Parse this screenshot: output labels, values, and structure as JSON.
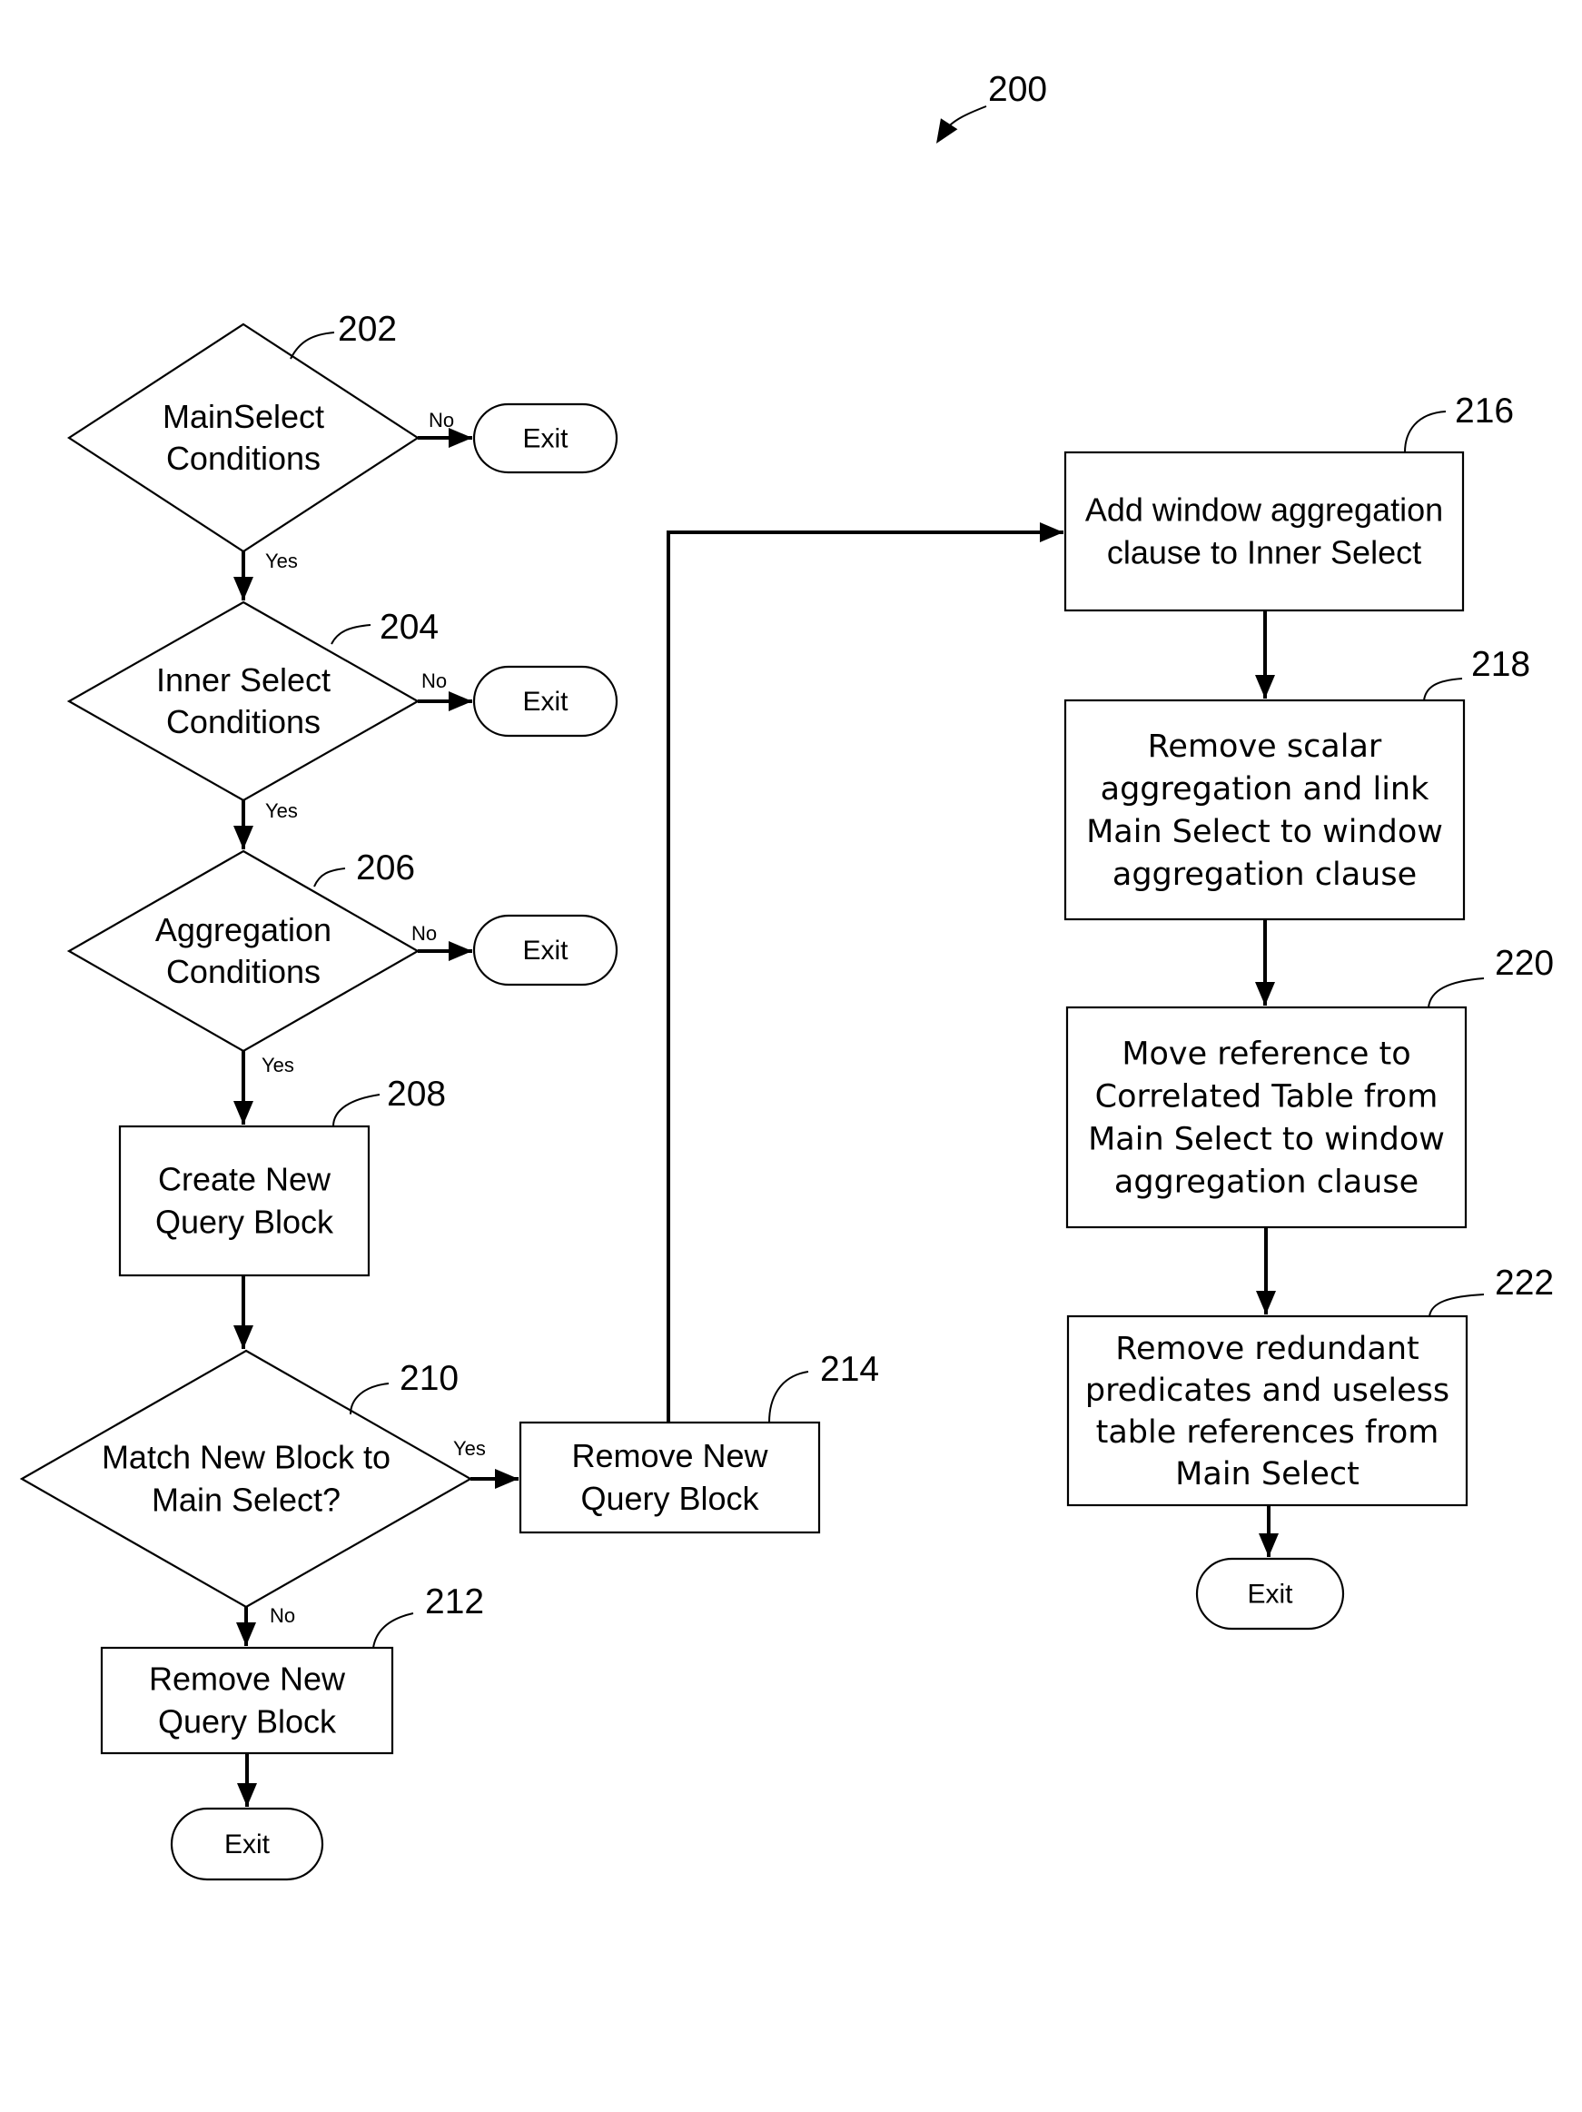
{
  "figure": {
    "reference": "200"
  },
  "nodes": {
    "n202": {
      "ref": "202",
      "type": "decision",
      "lines": [
        "MainSelect",
        "Conditions"
      ]
    },
    "n204": {
      "ref": "204",
      "type": "decision",
      "lines": [
        "Inner Select",
        "Conditions"
      ]
    },
    "n206": {
      "ref": "206",
      "type": "decision",
      "lines": [
        "Aggregation",
        "Conditions"
      ]
    },
    "n208": {
      "ref": "208",
      "type": "process",
      "lines": [
        "Create New",
        "Query Block"
      ]
    },
    "n210": {
      "ref": "210",
      "type": "decision",
      "lines": [
        "Match New Block to",
        "Main Select?"
      ]
    },
    "n212": {
      "ref": "212",
      "type": "process",
      "lines": [
        "Remove New",
        "Query Block"
      ]
    },
    "n214": {
      "ref": "214",
      "type": "process",
      "lines": [
        "Remove New",
        "Query Block"
      ]
    },
    "n216": {
      "ref": "216",
      "type": "process",
      "lines": [
        "Add window aggregation",
        "clause to Inner Select"
      ]
    },
    "n218": {
      "ref": "218",
      "type": "process",
      "lines": [
        "Remove scalar",
        "aggregation and link",
        "Main Select to window",
        "aggregation clause"
      ]
    },
    "n220": {
      "ref": "220",
      "type": "process",
      "lines": [
        "Move reference to",
        "Correlated Table from",
        "Main Select to window",
        "aggregation clause"
      ]
    },
    "n222": {
      "ref": "222",
      "type": "process",
      "lines": [
        "Remove redundant",
        "predicates and useless",
        "table references from",
        "Main Select"
      ]
    },
    "exit1": {
      "type": "terminal",
      "lines": [
        "Exit"
      ]
    },
    "exit2": {
      "type": "terminal",
      "lines": [
        "Exit"
      ]
    },
    "exit3": {
      "type": "terminal",
      "lines": [
        "Exit"
      ]
    },
    "exit4": {
      "type": "terminal",
      "lines": [
        "Exit"
      ]
    },
    "exit5": {
      "type": "terminal",
      "lines": [
        "Exit"
      ]
    }
  },
  "edges": [
    {
      "from": "n202",
      "to": "exit1",
      "label": "No"
    },
    {
      "from": "n202",
      "to": "n204",
      "label": "Yes"
    },
    {
      "from": "n204",
      "to": "exit2",
      "label": "No"
    },
    {
      "from": "n204",
      "to": "n206",
      "label": "Yes"
    },
    {
      "from": "n206",
      "to": "exit3",
      "label": "No"
    },
    {
      "from": "n206",
      "to": "n208",
      "label": "Yes"
    },
    {
      "from": "n208",
      "to": "n210",
      "label": ""
    },
    {
      "from": "n210",
      "to": "n214",
      "label": "Yes"
    },
    {
      "from": "n210",
      "to": "n212",
      "label": "No"
    },
    {
      "from": "n212",
      "to": "exit5",
      "label": ""
    },
    {
      "from": "n214",
      "to": "n216",
      "label": ""
    },
    {
      "from": "n216",
      "to": "n218",
      "label": ""
    },
    {
      "from": "n218",
      "to": "n220",
      "label": ""
    },
    {
      "from": "n220",
      "to": "n222",
      "label": ""
    },
    {
      "from": "n222",
      "to": "exit4",
      "label": ""
    }
  ]
}
